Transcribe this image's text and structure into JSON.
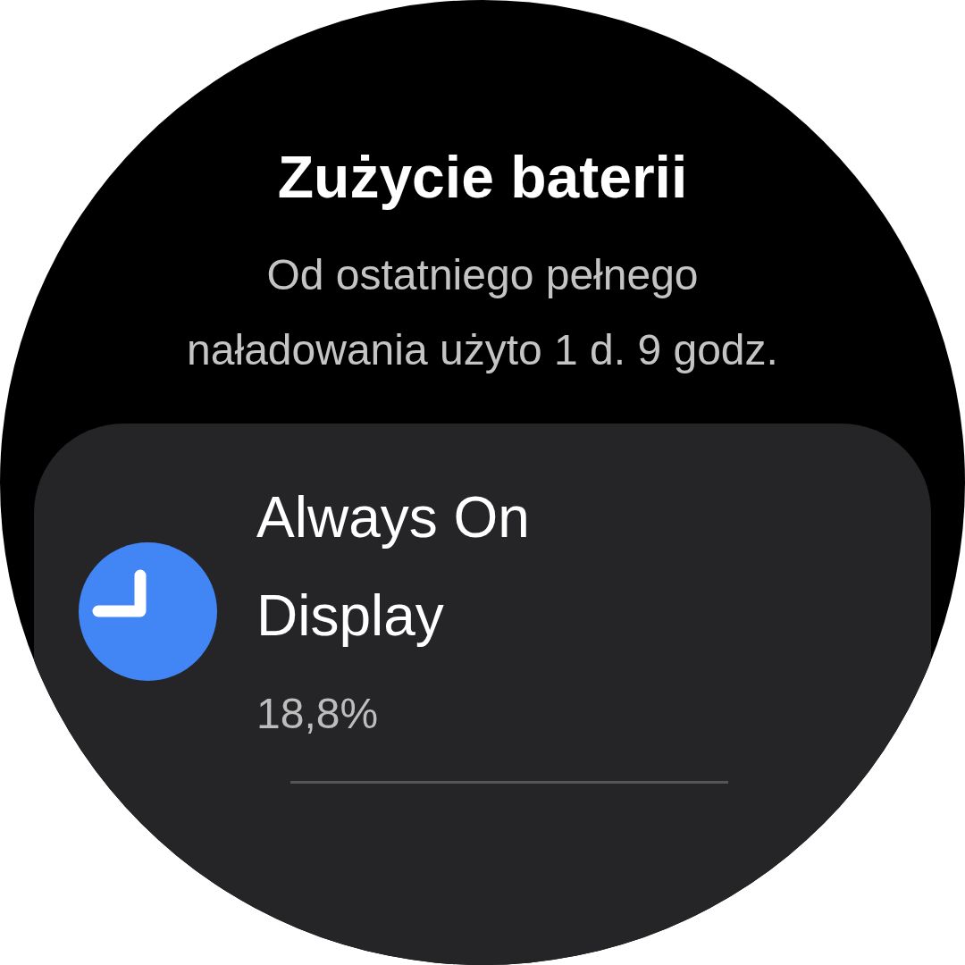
{
  "title": "Zużycie baterii",
  "subtitle": "Od ostatniego pełnego naładowania użyto 1 d. 9 godz.",
  "apps": [
    {
      "name": "Always On Display",
      "usage": "18,8%"
    }
  ]
}
